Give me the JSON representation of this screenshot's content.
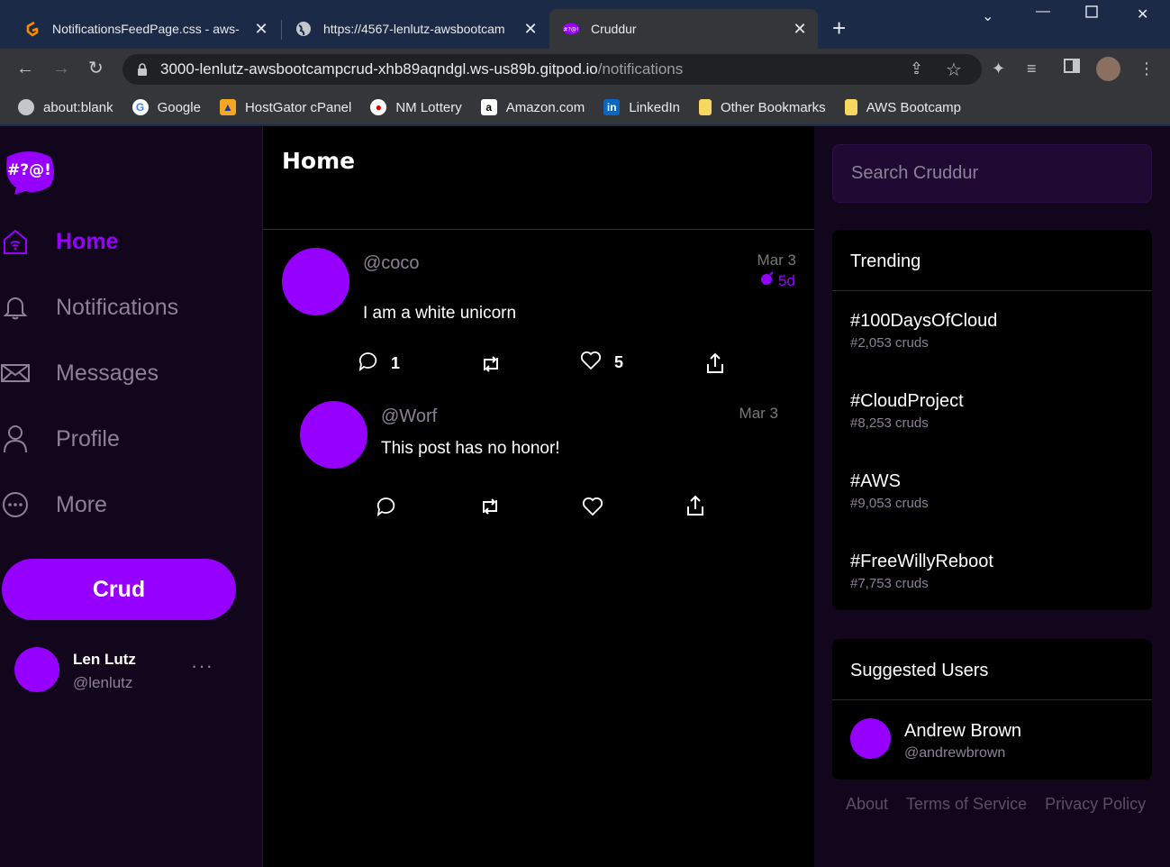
{
  "browser": {
    "tabs": [
      {
        "title": "NotificationsFeedPage.css - aws-",
        "favicon": "gitpod-icon",
        "active": false
      },
      {
        "title": "https://4567-lenlutz-awsbootcam",
        "favicon": "globe-icon",
        "active": false
      },
      {
        "title": "Cruddur",
        "favicon": "cruddur-icon",
        "active": true
      }
    ],
    "url_host": "3000-lenlutz-awsbootcampcrud-xhb89aqndgl.ws-us89b.gitpod.io",
    "url_path": "/notifications",
    "bookmarks": [
      {
        "label": "about:blank",
        "icon": "globe-icon"
      },
      {
        "label": "Google",
        "icon": "google-icon"
      },
      {
        "label": "HostGator cPanel",
        "icon": "hostgator-icon"
      },
      {
        "label": "NM Lottery",
        "icon": "lottery-icon"
      },
      {
        "label": "Amazon.com",
        "icon": "amazon-icon"
      },
      {
        "label": "LinkedIn",
        "icon": "linkedin-icon"
      },
      {
        "label": "Other Bookmarks",
        "icon": "folder-icon"
      },
      {
        "label": "AWS Bootcamp",
        "icon": "folder-icon"
      }
    ]
  },
  "sidebar": {
    "logo_text": "#?@!",
    "items": [
      {
        "label": "Home",
        "icon": "home-icon",
        "active": true
      },
      {
        "label": "Notifications",
        "icon": "bell-icon",
        "active": false
      },
      {
        "label": "Messages",
        "icon": "envelope-icon",
        "active": false
      },
      {
        "label": "Profile",
        "icon": "person-icon",
        "active": false
      },
      {
        "label": "More",
        "icon": "more-circle-icon",
        "active": false
      }
    ],
    "crud_button": "Crud",
    "user": {
      "name": "Len Lutz",
      "handle": "@lenlutz",
      "more": "···"
    }
  },
  "feed": {
    "title": "Home",
    "activities": [
      {
        "handle": "@coco",
        "date": "Mar 3",
        "expires": "5d",
        "message": "I am a white unicorn",
        "replies": "1",
        "reposts": "",
        "likes": "5"
      },
      {
        "handle": "@Worf",
        "date": "Mar 3",
        "message": "This post has no honor!",
        "replies": "",
        "reposts": "",
        "likes": ""
      }
    ]
  },
  "right": {
    "search_placeholder": "Search Cruddur",
    "trending_title": "Trending",
    "trending": [
      {
        "name": "#100DaysOfCloud",
        "count": "#2,053 cruds"
      },
      {
        "name": "#CloudProject",
        "count": "#8,253 cruds"
      },
      {
        "name": "#AWS",
        "count": "#9,053 cruds"
      },
      {
        "name": "#FreeWillyReboot",
        "count": "#7,753 cruds"
      }
    ],
    "suggested_title": "Suggested Users",
    "suggested": [
      {
        "name": "Andrew Brown",
        "handle": "@andrewbrown"
      }
    ],
    "footer": [
      "About",
      "Terms of Service",
      "Privacy Policy"
    ]
  },
  "colors": {
    "accent": "#9500ff",
    "sidebar_bg": "#12061c",
    "feed_bg": "#000000"
  }
}
